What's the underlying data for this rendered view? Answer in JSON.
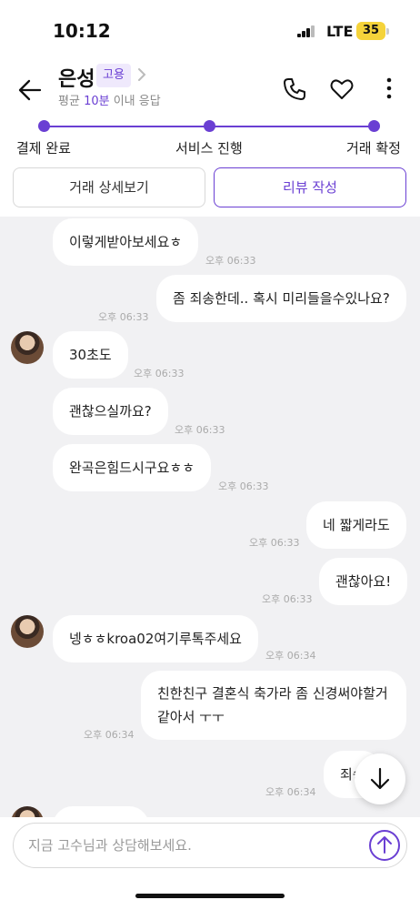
{
  "status_bar": {
    "time": "10:12",
    "network": "LTE",
    "battery": "35"
  },
  "header": {
    "name": "은성",
    "badge": "고용",
    "response_prefix": "평균 ",
    "response_highlight": "10분",
    "response_suffix": " 이내 응답"
  },
  "progress": {
    "steps": [
      "결제 완료",
      "서비스 진행",
      "거래 확정"
    ]
  },
  "actions": {
    "detail_label": "거래 상세보기",
    "review_label": "리뷰 작성"
  },
  "chat": {
    "messages": [
      {
        "side": "left",
        "text": "이렇게받아보세요ㅎ",
        "time": "오후 06:33"
      },
      {
        "side": "right",
        "text": "좀 죄송한데.. 혹시 미리들을수있나요?",
        "time": "오후 06:33"
      },
      {
        "side": "left",
        "text": "30초도",
        "time": "오후 06:33"
      },
      {
        "side": "left",
        "text": "괜찮으실까요?",
        "time": "오후 06:33"
      },
      {
        "side": "left",
        "text": "완곡은힘드시구요ㅎㅎ",
        "time": "오후 06:33"
      },
      {
        "side": "right",
        "text": "네 짧게라도",
        "time": "오후 06:33"
      },
      {
        "side": "right",
        "text": "괜찮아요!",
        "time": "오후 06:33"
      },
      {
        "side": "left",
        "text": "넹ㅎㅎkroa02여기루톡주세요",
        "time": "오후 06:34"
      },
      {
        "side": "right",
        "text": "친한친구 결혼식 축가라 좀 신경써야할거 같아서 ㅜㅜ",
        "time": "오후 06:34"
      },
      {
        "side": "right",
        "text": "죄송",
        "time": "오후 06:34"
      }
    ]
  },
  "input": {
    "placeholder": "지금 고수님과 상담해보세요."
  },
  "colors": {
    "accent": "#6a3fd3",
    "chat_bg": "#f1f1f3",
    "badge_bg": "#efe9fc"
  }
}
